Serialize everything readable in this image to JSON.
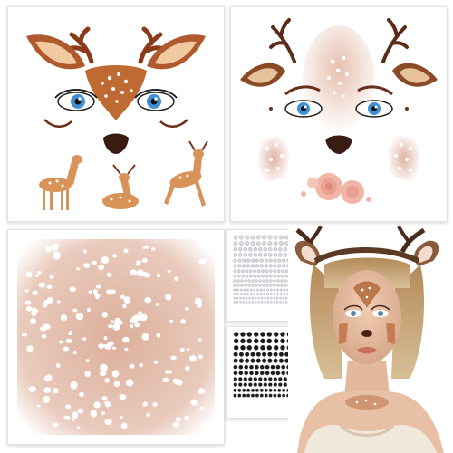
{
  "colors": {
    "brown_dark": "#6a2f18",
    "brown_mid": "#b0592d",
    "tan": "#e0a36a",
    "skin_pink": "#e8c3b6",
    "eye_blue": "#3f8fd8",
    "nose": "#3a1b12",
    "rose": "#f2b6a8",
    "rhinestone_silver": "#d8dbe0",
    "rhinestone_black": "#1b1b1b"
  },
  "products": [
    {
      "name": "cartoon-deer-face-sticker-sheet"
    },
    {
      "name": "realistic-deer-face-sticker-sheet"
    },
    {
      "name": "deer-spots-body-sticker-sheet"
    },
    {
      "name": "silver-rhinestone-sheet"
    },
    {
      "name": "black-rhinestone-sheet"
    },
    {
      "name": "model-wearing-deer-makeup"
    }
  ]
}
